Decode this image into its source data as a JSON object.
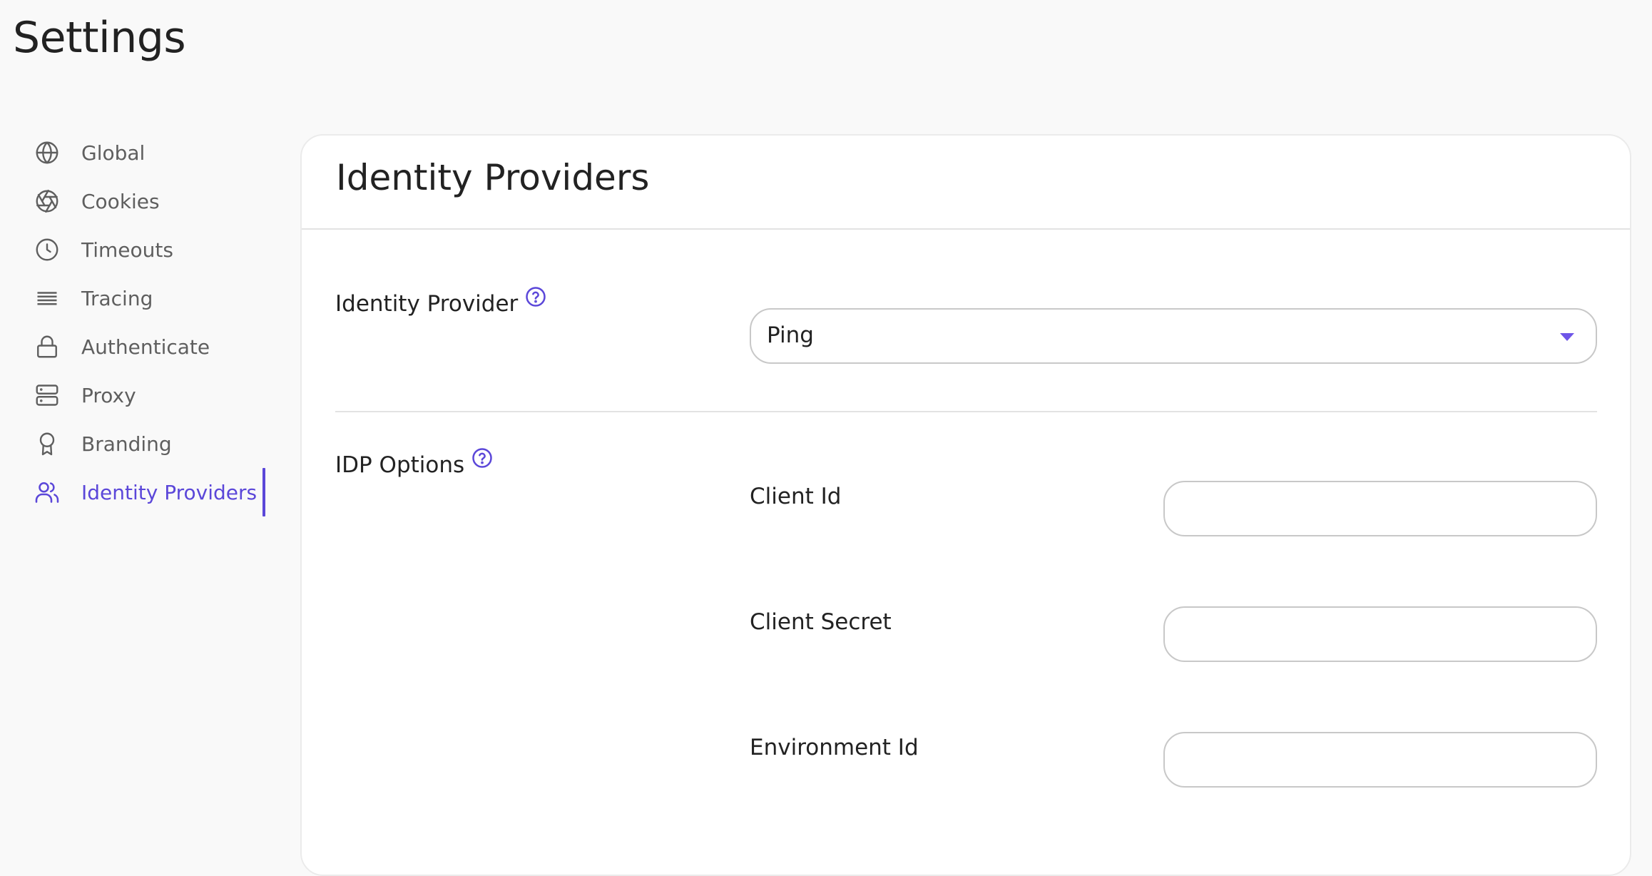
{
  "page": {
    "title": "Settings"
  },
  "sidebar": {
    "items": [
      {
        "label": "Global",
        "icon": "globe-icon",
        "active": false
      },
      {
        "label": "Cookies",
        "icon": "aperture-icon",
        "active": false
      },
      {
        "label": "Timeouts",
        "icon": "clock-icon",
        "active": false
      },
      {
        "label": "Tracing",
        "icon": "lines-icon",
        "active": false
      },
      {
        "label": "Authenticate",
        "icon": "lock-icon",
        "active": false
      },
      {
        "label": "Proxy",
        "icon": "server-icon",
        "active": false
      },
      {
        "label": "Branding",
        "icon": "award-icon",
        "active": false
      },
      {
        "label": "Identity Providers",
        "icon": "users-icon",
        "active": true
      }
    ]
  },
  "colors": {
    "accent": "#5b47d9",
    "caret": "#6e55e8",
    "text": "#222222",
    "muted_text": "#5f5f5f",
    "border": "#c8c8c8",
    "background": "#f9f9f9"
  },
  "card": {
    "title": "Identity Providers",
    "identity_provider": {
      "label": "Identity Provider",
      "help_icon": "help-circle-icon",
      "selected": "Ping"
    },
    "idp_options": {
      "label": "IDP Options",
      "help_icon": "help-circle-icon",
      "fields": [
        {
          "label": "Client Id",
          "value": "",
          "placeholder": ""
        },
        {
          "label": "Client Secret",
          "value": "",
          "placeholder": ""
        },
        {
          "label": "Environment Id",
          "value": "",
          "placeholder": ""
        }
      ]
    }
  }
}
